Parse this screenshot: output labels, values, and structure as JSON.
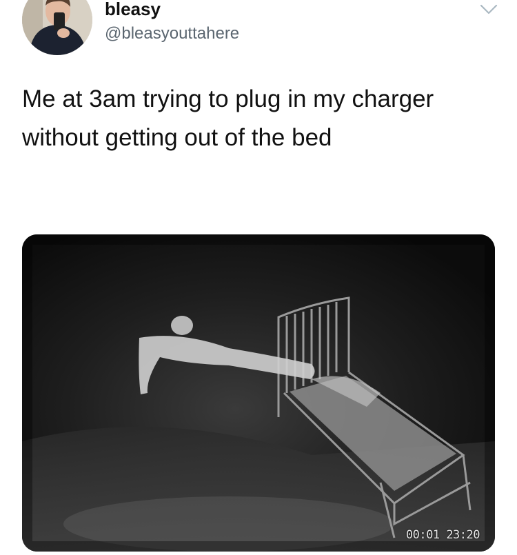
{
  "author": {
    "display_name": "bleasy",
    "handle": "@bleasyouttahere"
  },
  "icons": {
    "menu": "chevron-down-icon",
    "avatar": "profile-photo"
  },
  "tweet": {
    "text": "Me at 3am trying to plug in my charger without getting out of the bed"
  },
  "media": {
    "timestamp_overlay": "00:01 23:20"
  },
  "colors": {
    "text": "#14171a",
    "handle": "#5b6670",
    "chevron": "#aab8c2"
  }
}
